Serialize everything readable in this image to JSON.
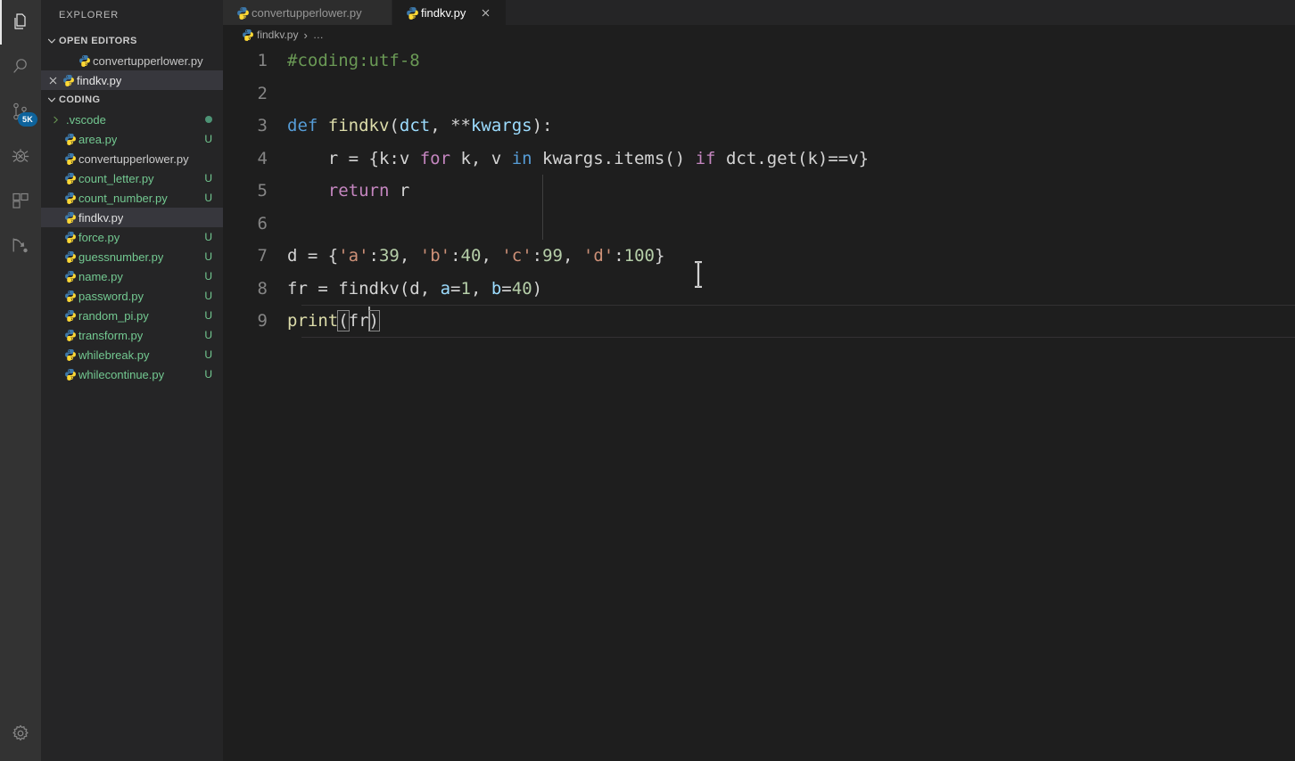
{
  "activitybar": {
    "items": [
      {
        "name": "explorer-icon",
        "title": "Explorer",
        "active": true,
        "badge": ""
      },
      {
        "name": "search-icon",
        "title": "Search",
        "active": false,
        "badge": ""
      },
      {
        "name": "source-control-icon",
        "title": "Source Control",
        "active": false,
        "badge": "5K"
      },
      {
        "name": "run-debug-icon",
        "title": "Run and Debug",
        "active": false,
        "badge": ""
      },
      {
        "name": "extensions-icon",
        "title": "Extensions",
        "active": false,
        "badge": ""
      },
      {
        "name": "live-share-icon",
        "title": "Live Share",
        "active": false,
        "badge": ""
      }
    ],
    "bottom": {
      "name": "manage-gear-icon",
      "title": "Manage"
    },
    "badge_color": "#0e639c"
  },
  "sidebar": {
    "title": "EXPLORER",
    "open_editors": {
      "label": "OPEN EDITORS",
      "expanded": true,
      "items": [
        {
          "label": "convertupperlower.py",
          "icon": "python-icon",
          "selected": false,
          "closable": false
        },
        {
          "label": "findkv.py",
          "icon": "python-icon",
          "selected": true,
          "closable": true
        }
      ]
    },
    "folder": {
      "label": "CODING",
      "expanded": true,
      "items": [
        {
          "label": ".vscode",
          "icon": "chevron-right-icon",
          "kind": "folder",
          "badge": "",
          "status_dot": "#4d9375",
          "color": "#73c991",
          "selected": false
        },
        {
          "label": "area.py",
          "icon": "python-icon",
          "kind": "file",
          "badge": "U",
          "color": "#73c991",
          "selected": false
        },
        {
          "label": "convertupperlower.py",
          "icon": "python-icon",
          "kind": "file",
          "badge": "",
          "color": "#cccccc",
          "selected": false
        },
        {
          "label": "count_letter.py",
          "icon": "python-icon",
          "kind": "file",
          "badge": "U",
          "color": "#73c991",
          "selected": false
        },
        {
          "label": "count_number.py",
          "icon": "python-icon",
          "kind": "file",
          "badge": "U",
          "color": "#73c991",
          "selected": false
        },
        {
          "label": "findkv.py",
          "icon": "python-icon",
          "kind": "file",
          "badge": "",
          "color": "#cccccc",
          "selected": true
        },
        {
          "label": "force.py",
          "icon": "python-icon",
          "kind": "file",
          "badge": "U",
          "color": "#73c991",
          "selected": false
        },
        {
          "label": "guessnumber.py",
          "icon": "python-icon",
          "kind": "file",
          "badge": "U",
          "color": "#73c991",
          "selected": false
        },
        {
          "label": "name.py",
          "icon": "python-icon",
          "kind": "file",
          "badge": "U",
          "color": "#73c991",
          "selected": false
        },
        {
          "label": "password.py",
          "icon": "python-icon",
          "kind": "file",
          "badge": "U",
          "color": "#73c991",
          "selected": false
        },
        {
          "label": "random_pi.py",
          "icon": "python-icon",
          "kind": "file",
          "badge": "U",
          "color": "#73c991",
          "selected": false
        },
        {
          "label": "transform.py",
          "icon": "python-icon",
          "kind": "file",
          "badge": "U",
          "color": "#73c991",
          "selected": false
        },
        {
          "label": "whilebreak.py",
          "icon": "python-icon",
          "kind": "file",
          "badge": "U",
          "color": "#73c991",
          "selected": false
        },
        {
          "label": "whilecontinue.py",
          "icon": "python-icon",
          "kind": "file",
          "badge": "U",
          "color": "#73c991",
          "selected": false
        }
      ]
    }
  },
  "editor": {
    "tabs": [
      {
        "label": "convertupperlower.py",
        "icon": "python-icon",
        "active": false,
        "close": ""
      },
      {
        "label": "findkv.py",
        "icon": "python-icon",
        "active": true,
        "close": "✕"
      }
    ],
    "breadcrumb": {
      "file": "findkv.py",
      "separator": "›",
      "more": "…"
    },
    "cursor_line": 9,
    "lines": [
      {
        "n": "1",
        "text": "#coding:utf-8"
      },
      {
        "n": "2",
        "text": ""
      },
      {
        "n": "3",
        "text": "def findkv(dct, **kwargs):"
      },
      {
        "n": "4",
        "text": "    r = {k:v for k, v in kwargs.items() if dct.get(k)==v}"
      },
      {
        "n": "5",
        "text": "    return r"
      },
      {
        "n": "6",
        "text": ""
      },
      {
        "n": "7",
        "text": "d = {'a':39, 'b':40, 'c':99, 'd':100}"
      },
      {
        "n": "8",
        "text": "fr = findkv(d, a=1, b=40)"
      },
      {
        "n": "9",
        "text": "print(fr)"
      }
    ],
    "colors": {
      "background": "#1e1e1e",
      "line_number": "#858585",
      "comment": "#6a9955",
      "keyword": "#569cd6",
      "control": "#c586c0",
      "function": "#dcdcaa",
      "parameter": "#9cdcfe",
      "string": "#ce9178",
      "number": "#b5cea8",
      "plain": "#d4d4d4",
      "cursor": "#aeafad"
    }
  },
  "theme": {
    "activitybar_bg": "#333333",
    "sidebar_bg": "#252526",
    "tabbar_bg": "#252526",
    "active_tab_bg": "#1e1e1e",
    "selection_bg": "#37373d"
  }
}
